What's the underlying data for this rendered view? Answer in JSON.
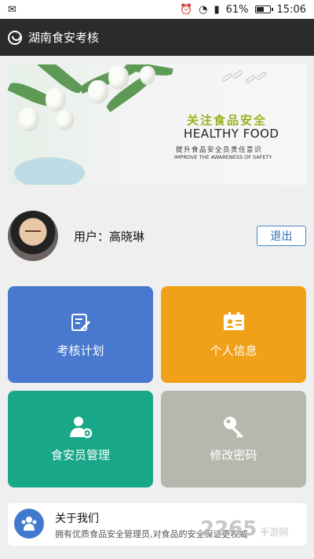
{
  "statusbar": {
    "battery": "61%",
    "battery_level": 0.61,
    "time": "15:06"
  },
  "app": {
    "title": "湖南食安考核"
  },
  "banner": {
    "headline_cn": "关注食品安全",
    "headline_en": "HEALTHY FOOD",
    "subline_cn": "提升食品安全员责任意识",
    "subline_en": "IMPROVE THE AWARENESS OF SAFETY"
  },
  "user": {
    "label": "用户：高晓琳",
    "logout": "退出"
  },
  "tiles": [
    {
      "label": "考核计划",
      "color": "#4879cf",
      "icon": "clipboard-edit-icon"
    },
    {
      "label": "个人信息",
      "color": "#f0a117",
      "icon": "id-card-icon"
    },
    {
      "label": "食安员管理",
      "color": "#18a789",
      "icon": "user-gear-icon"
    },
    {
      "label": "修改密码",
      "color": "#b6b8ae",
      "icon": "key-icon"
    }
  ],
  "about": {
    "title": "关于我们",
    "description": "拥有优质食品安全管理员,对食品的安全保证更权威"
  },
  "watermark": {
    "text": "2265",
    "suffix": "手游网"
  }
}
